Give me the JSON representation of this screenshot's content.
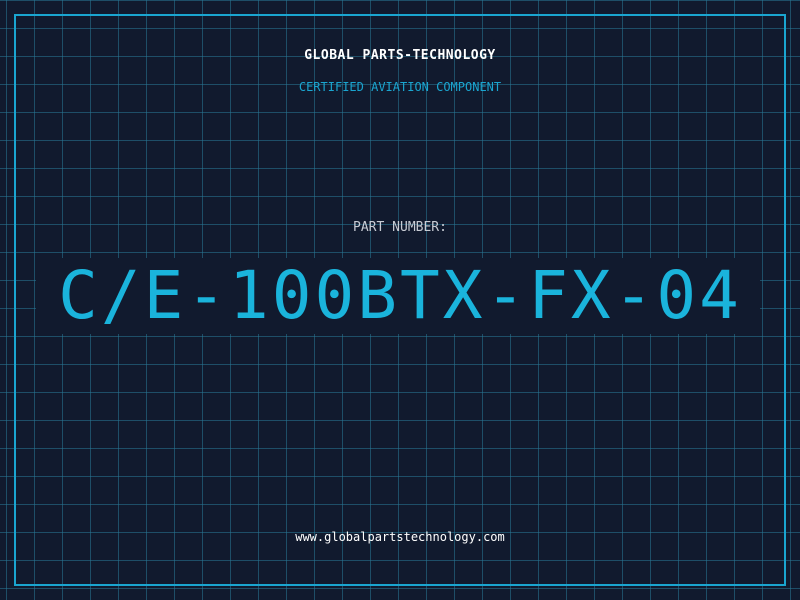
{
  "header": {
    "company": "GLOBAL PARTS-TECHNOLOGY",
    "subtitle": "CERTIFIED AVIATION COMPONENT"
  },
  "part": {
    "label": "PART NUMBER:",
    "number": "C/E-100BTX-FX-04"
  },
  "footer": {
    "website": "www.globalpartstechnology.com"
  },
  "colors": {
    "background": "#111a2e",
    "accent": "#1aa5d0",
    "text": "#ffffff",
    "label": "#c8ccd4"
  }
}
